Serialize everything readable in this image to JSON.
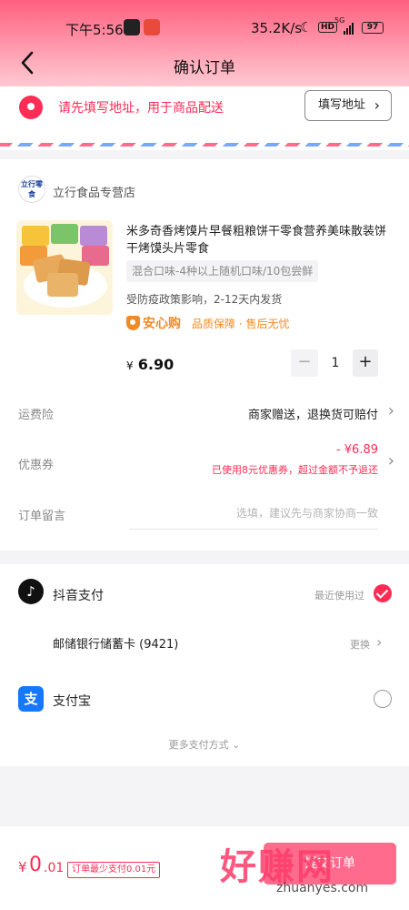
{
  "status_bar": {
    "time": "下午5:56",
    "net_rate": "35.2K/s",
    "hd": "HD",
    "signal": "5G",
    "battery": "97"
  },
  "nav": {
    "title": "确认订单"
  },
  "address": {
    "hint": "请先填写地址，用于商品配送",
    "button_label": "填写地址"
  },
  "shop": {
    "logo_text": "立行零食",
    "name": "立行食品专营店"
  },
  "product": {
    "title": "米多奇香烤馍片早餐粗粮饼干零食营养美味散装饼干烤馍头片零食",
    "spec": "混合口味-4种以上随机口味/10包尝鲜",
    "ship_note": "受防疫政策影响，2-12天内发货",
    "guarantee_brand": "安心购",
    "guarantee_desc": "品质保障 · 售后无忧",
    "price_symbol": "¥",
    "price": "6.90",
    "qty_minus": "−",
    "quantity": "1",
    "qty_plus": "+"
  },
  "rows": {
    "insurance_label": "运费险",
    "insurance_value": "商家赠送，退换货可赔付",
    "coupon_label": "优惠券",
    "coupon_amount": "- ¥6.89",
    "coupon_note": "已使用8元优惠券，超过金额不予退还",
    "memo_label": "订单留言",
    "memo_placeholder": "选填，建议先与商家协商一致"
  },
  "payment": {
    "douyin_label": "抖音支付",
    "recent_label": "最近使用过",
    "bank_card": "邮储银行储蓄卡 (9421)",
    "change_label": "更换",
    "alipay_label": "支付宝",
    "more_label": "更多支付方式"
  },
  "bottom": {
    "currency": "¥",
    "amount_int": "0",
    "amount_dec": ".01",
    "min_tag": "订单最少支付0.01元",
    "submit_label": "提交订单"
  },
  "watermark": {
    "main": "好赚网",
    "sub": "zhuanyes.com"
  },
  "colors": {
    "accent": "#fe2c55",
    "guarantee": "#f08a24",
    "alipay": "#1677ff"
  }
}
